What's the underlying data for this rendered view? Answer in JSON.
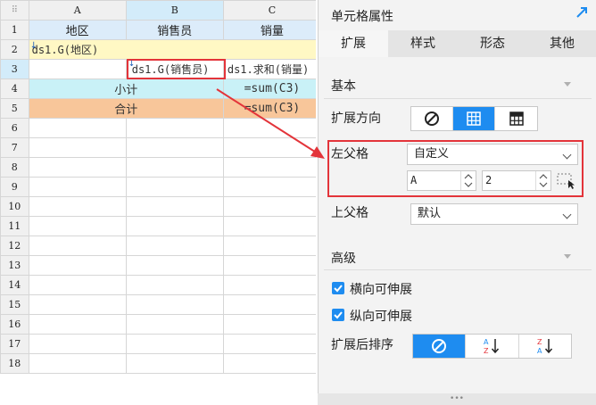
{
  "sheet": {
    "col_headers": [
      "A",
      "B",
      "C"
    ],
    "row_numbers": [
      "1",
      "2",
      "3",
      "4",
      "5",
      "6",
      "7",
      "8",
      "9",
      "10",
      "11",
      "12",
      "13",
      "14",
      "15",
      "16",
      "17",
      "18"
    ],
    "cells": {
      "a1": "地区",
      "b1": "销售员",
      "c1": "销量",
      "a2": "ds1.G(地区)",
      "b3": "ds1.G(销售员)",
      "c3": "ds1.求和(销量)",
      "ab4": "小计",
      "c4": "=sum(C3)",
      "ab5": "合计",
      "c5": "=sum(C3)"
    },
    "colors": {
      "header_fill": "#dcecfa",
      "row2_fill": "#fff8c4",
      "row4_fill": "#c9f1f7",
      "row5_fill": "#f8c69a",
      "highlight": "#e3343a"
    }
  },
  "panel": {
    "title": "单元格属性",
    "tabs": [
      "扩展",
      "样式",
      "形态",
      "其他"
    ],
    "active_tab": "扩展",
    "basic": {
      "section_title": "基本",
      "expand_direction_label": "扩展方向",
      "expand_direction_options": [
        "no-expand-icon",
        "vertical-expand-icon",
        "horizontal-expand-icon"
      ],
      "expand_direction_selected": "vertical-expand-icon",
      "left_parent_label": "左父格",
      "left_parent_mode": "自定义",
      "left_parent_col": "A",
      "left_parent_row": "2",
      "top_parent_label": "上父格",
      "top_parent_mode": "默认"
    },
    "advanced": {
      "section_title": "高级",
      "horizontal_extendable": "横向可伸展",
      "vertical_extendable": "纵向可伸展",
      "sort_label": "扩展后排序",
      "sort_options": [
        "no-sort-icon",
        "sort-ascending-icon",
        "sort-descending-icon"
      ],
      "sort_selected": "no-sort-icon"
    },
    "accent_color": "#1e8cf0"
  },
  "corner_glyph": "⠿",
  "bottom_handle": "•••"
}
